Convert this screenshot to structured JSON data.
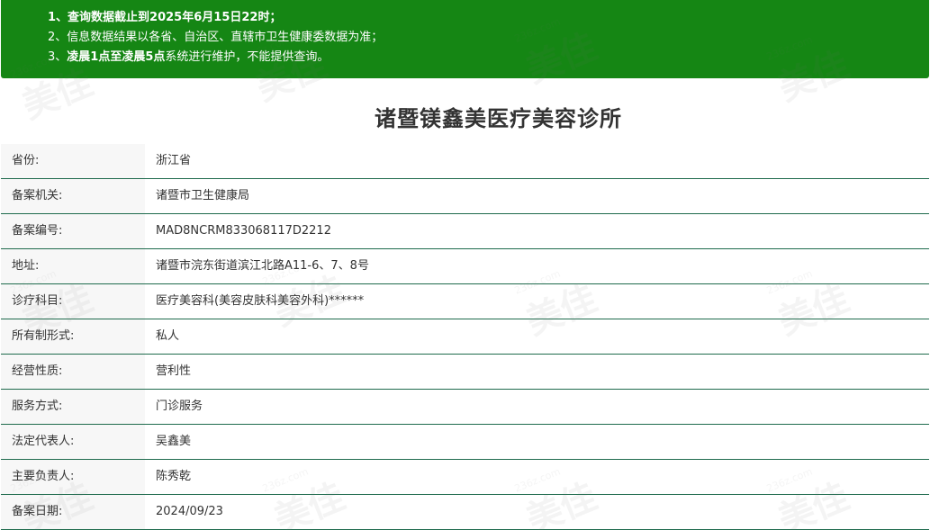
{
  "notice": {
    "line1": "1、查询数据截止到2025年6月15日22时；",
    "line2": "2、信息数据结果以各省、自治区、直辖市卫生健康委数据为准；",
    "line3_prefix": "3、",
    "line3_bold": "凌晨1点至凌晨5点",
    "line3_suffix": "系统进行维护，不能提供查询。"
  },
  "title": "诸暨镁鑫美医疗美容诊所",
  "rows": [
    {
      "label": "省份:",
      "value": "浙江省"
    },
    {
      "label": "备案机关:",
      "value": "诸暨市卫生健康局"
    },
    {
      "label": "备案编号:",
      "value": "MAD8NCRM833068117D2212"
    },
    {
      "label": "地址:",
      "value": "诸暨市浣东街道滨江北路A11-6、7、8号"
    },
    {
      "label": "诊疗科目:",
      "value": "医疗美容科(美容皮肤科美容外科)******"
    },
    {
      "label": "所有制形式:",
      "value": "私人"
    },
    {
      "label": "经营性质:",
      "value": "营利性"
    },
    {
      "label": "服务方式:",
      "value": "门诊服务"
    },
    {
      "label": "法定代表人:",
      "value": "吴鑫美"
    },
    {
      "label": "主要负责人:",
      "value": "陈秀乾"
    },
    {
      "label": "备案日期:",
      "value": "2024/09/23"
    }
  ],
  "watermark": {
    "brand": "美佳",
    "domain": "236z.com"
  },
  "colors": {
    "notice_bg": "#158614",
    "row_border": "#1f6b4d",
    "label_bg": "#f7f7f7"
  }
}
